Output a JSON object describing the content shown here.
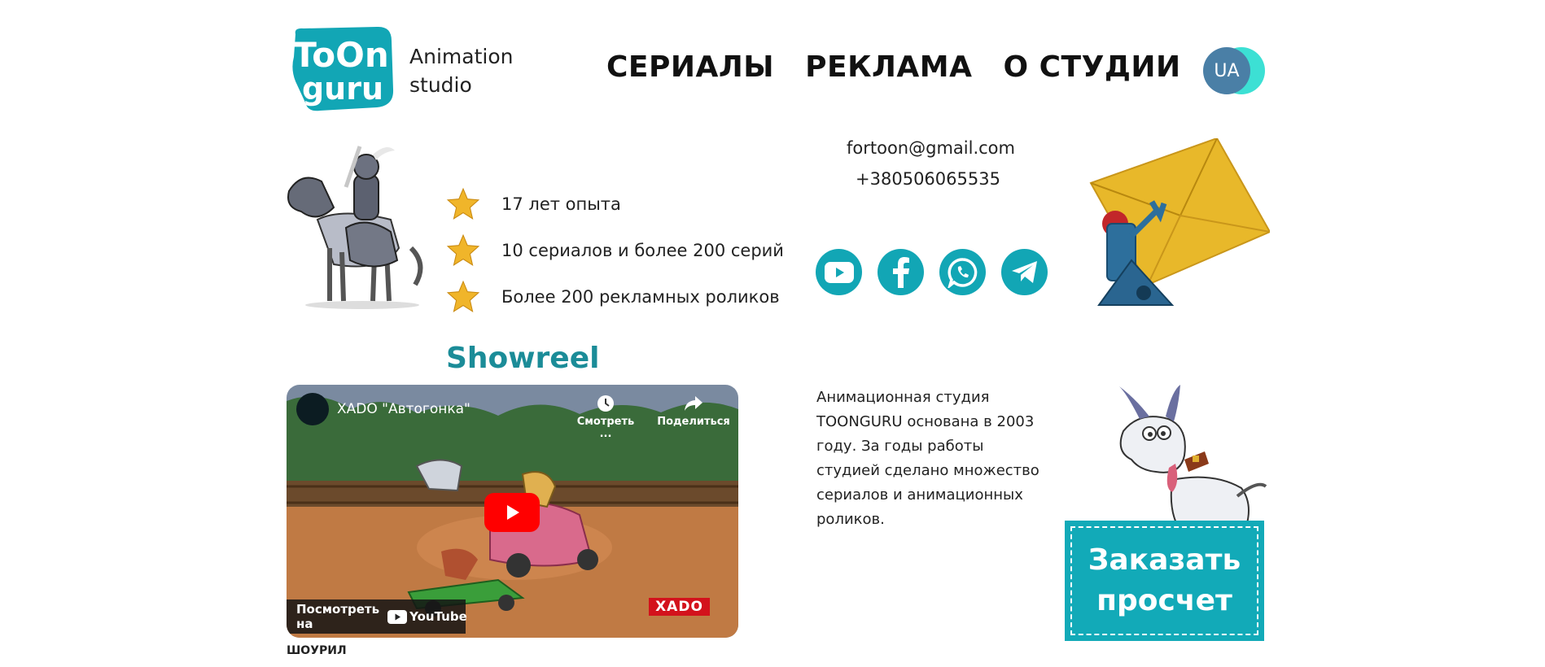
{
  "header": {
    "logo_top": "ToOn",
    "logo_bottom": "guru",
    "logo_subtitle_line1": "Animation",
    "logo_subtitle_line2": "studio",
    "nav": [
      "СЕРИАЛЫ",
      "РЕКЛАМА",
      "О СТУДИИ"
    ],
    "lang_label": "UA"
  },
  "features": [
    "17 лет опыта",
    "10 сериалов и более 200 серий",
    "Более 200 рекламных роликов"
  ],
  "contacts": {
    "email": "fortoon@gmail.com",
    "phone": "+380506065535",
    "socials": [
      "youtube-icon",
      "facebook-icon",
      "whatsapp-icon",
      "telegram-icon"
    ]
  },
  "showreel": {
    "title": "Showreel",
    "video_title": "XADO \"Автогонка\"",
    "watch_later": "Смотреть ...",
    "share": "Поделиться",
    "watch_on": "Посмотреть на",
    "youtube_wordmark": "YouTube",
    "brand": "XADO",
    "caption": "ШОУРИЛ"
  },
  "about": {
    "text": "Анимационная студия TOONGURU основана в 2003 году. За годы работы студией сделано множество сериалов и анимационных роликов."
  },
  "order_button": {
    "line1": "Заказать",
    "line2": "просчет"
  },
  "colors": {
    "accent": "#12a6b5",
    "title": "#1b8c98",
    "lang_bg": "#4a7fa6",
    "lang_shadow": "#3ce0d4",
    "star": "#f0b52a"
  }
}
